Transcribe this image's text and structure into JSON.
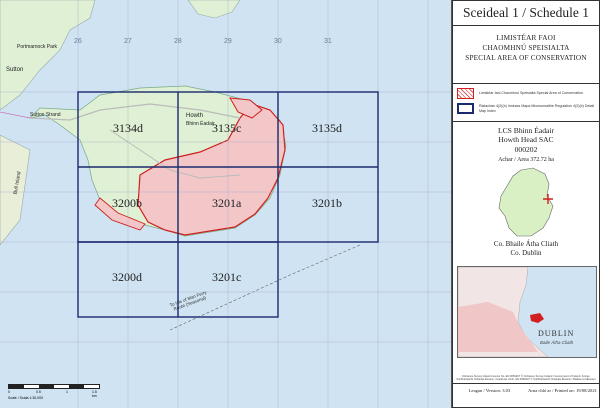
{
  "map": {
    "grid_numbers": [
      "26",
      "27",
      "28",
      "29",
      "30",
      "31"
    ],
    "tiles": [
      "3134d",
      "3135c",
      "3135d",
      "3200b",
      "3201a",
      "3201b",
      "3200d",
      "3201c"
    ],
    "places": {
      "portmarnock_park": "Portmarnock Park",
      "sutton": "Sutton",
      "sutton_strand": "Sutton Strand",
      "howth": "Howth",
      "bhinn": "Bhinn Éadair",
      "bull": "Bull Island"
    },
    "ferry": "To Isle of Man Ferry Route (Seasonal)",
    "scale": {
      "ticks": [
        "0",
        "0.5",
        "1",
        "1.5 km"
      ],
      "ratio": "Scale / Scála 1:30,000"
    },
    "colors": {
      "sea": "#cfe3f2",
      "land": "#dff0d4",
      "sac": "#d02020",
      "grid": "#1a2a6e"
    }
  },
  "panel": {
    "title": "Sceideal 1 / Schedule 1",
    "heading": [
      "LIMISTÉAR FAOI",
      "CHAOMHNÚ SPEISIALTA",
      "SPECIAL AREA OF CONSERVATION"
    ],
    "legend": [
      {
        "swatch": "sac",
        "text": "Limistéar faoi Chaomhnú Speisialta Special Area of Conservation"
      },
      {
        "swatch": "grid",
        "text": "Rialachán 4(2)(b) Innéacs Mapa Mionsonraithe Regulation 4(2)(b) Detail Map Index"
      }
    ],
    "site": {
      "name_ga": "LCS Bhinn Éadair",
      "name_en": "Howth Head SAC",
      "code": "000202",
      "area": "Achar / Area 372.72 ha"
    },
    "county": {
      "ga": "Co. Bhaile Átha Cliath",
      "en": "Co. Dublin"
    },
    "inset": {
      "city": "DUBLIN",
      "city_ga": "Baile Átha Cliath"
    },
    "footer_small": "Ordnance Survey Ireland Licence No. EN 0059207 © Ordnance Survey Ireland / Government of Ireland. Foinse: Suirbhéireacht Ordanáis Éireann. Ceadúnas Uimh. EN 0059207 © Suirbhéireacht Ordanáis Éireann / Rialtas na hÉireann",
    "version": "Leagan / Version: 3.03",
    "printed": "Arna chló ar / Printed on: 19/08/2021"
  }
}
